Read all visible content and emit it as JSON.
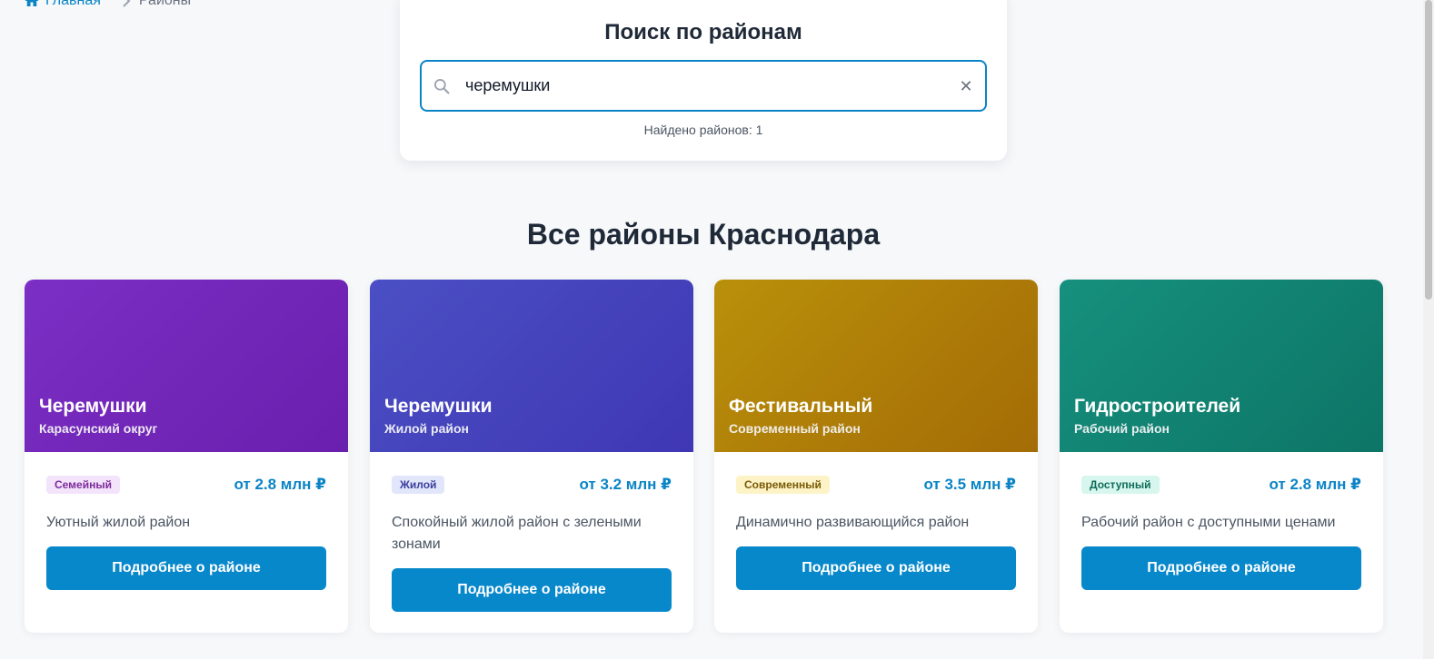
{
  "breadcrumb": {
    "home_label": "Главная",
    "current_label": "Районы",
    "home_icon": "home-icon",
    "separator_icon": "chevron-right-icon"
  },
  "search": {
    "title": "Поиск по районам",
    "value": "черемушки",
    "placeholder": "",
    "result_text": "Найдено районов: 1",
    "search_icon": "search-icon",
    "clear_icon": "close-icon"
  },
  "section": {
    "title": "Все районы Краснодара"
  },
  "colors": {
    "accent": "#0a84c6",
    "button": "#0788cb"
  },
  "districts": [
    {
      "name": "Черемушки",
      "subtitle": "Карасунский округ",
      "tag": "Семейный",
      "price": "от 2.8 млн ₽",
      "description": "Уютный жилой район",
      "button_label": "Подробнее о районе",
      "gradient": [
        "#7c2fc4",
        "#6a1fae"
      ],
      "tag_bg": "#f3e3fb",
      "tag_color": "#7b2b9a"
    },
    {
      "name": "Черемушки",
      "subtitle": "Жилой район",
      "tag": "Жилой",
      "price": "от 3.2 млн ₽",
      "description": "Спокойный жилой район с зелеными зонами",
      "button_label": "Подробнее о районе",
      "gradient": [
        "#4b4fc4",
        "#3f37b4"
      ],
      "tag_bg": "#e2e6fb",
      "tag_color": "#3b3f9c"
    },
    {
      "name": "Фестивальный",
      "subtitle": "Современный район",
      "tag": "Современный",
      "price": "от 3.5 млн ₽",
      "description": "Динамично развивающийся район",
      "button_label": "Подробнее о районе",
      "gradient": [
        "#b9900a",
        "#a46c06"
      ],
      "tag_bg": "#fdf3c7",
      "tag_color": "#7a5a06"
    },
    {
      "name": "Гидростроителей",
      "subtitle": "Рабочий район",
      "tag": "Доступный",
      "price": "от 2.8 млн ₽",
      "description": "Рабочий район с доступными ценами",
      "button_label": "Подробнее о районе",
      "gradient": [
        "#16907e",
        "#0d7566"
      ],
      "tag_bg": "#d6f6ee",
      "tag_color": "#0f6b5a"
    }
  ]
}
